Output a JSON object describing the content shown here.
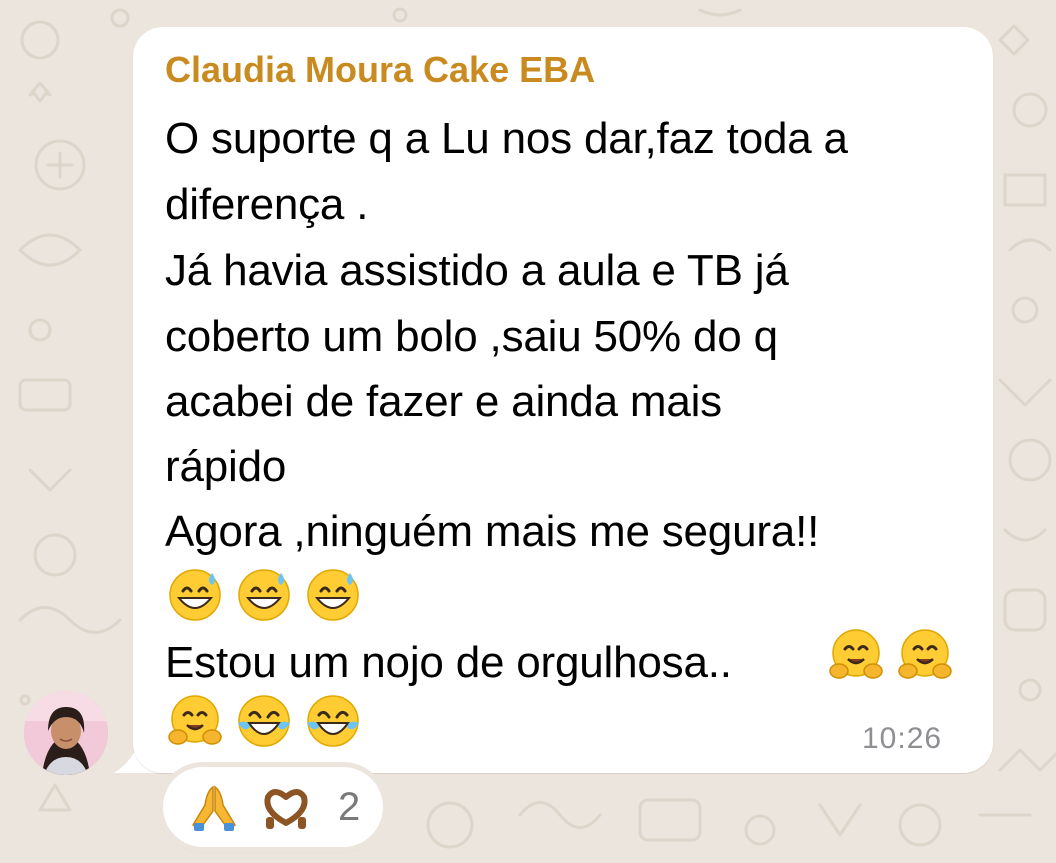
{
  "message": {
    "sender_name": "Claudia Moura Cake EBA",
    "lines": [
      "O suporte q a Lu nos dar,faz toda a",
      "diferença .",
      "Já havia assistido a aula e TB já",
      "coberto um bolo ,saiu 50% do q",
      "acabei de fazer e ainda mais",
      "rápido",
      "Agora ,ninguém mais me segura!!",
      "",
      "Estou um nojo de orgulhosa.."
    ],
    "time": "10:26"
  },
  "emojis": [
    "grinning-face-with-sweat-icon",
    "grinning-face-with-sweat-icon",
    "grinning-face-with-sweat-icon",
    "hugging-face-icon",
    "hugging-face-icon",
    "hugging-face-icon",
    "face-with-tears-of-joy-icon",
    "face-with-tears-of-joy-icon"
  ],
  "reactions": {
    "icons": [
      "folded-hands-icon",
      "heart-hands-icon"
    ],
    "count": "2"
  },
  "colors": {
    "background": "#ece5dd",
    "bubble": "#ffffff",
    "sender_name": "#c98a1f",
    "message_text": "#000000",
    "timestamp": "#8e8e93",
    "reaction_count": "#7a7a7a"
  }
}
